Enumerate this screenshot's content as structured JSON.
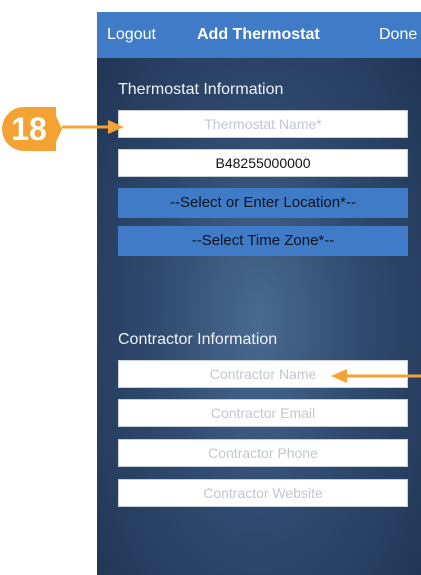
{
  "navbar": {
    "logout_label": "Logout",
    "title": "Add Thermostat",
    "done_label": "Done"
  },
  "thermostat_section": {
    "title": "Thermostat Information",
    "name_placeholder": "Thermostat Name*",
    "serial_value": "B48255000000",
    "location_label": "--Select or Enter Location*--",
    "timezone_label": "--Select Time Zone*--"
  },
  "contractor_section": {
    "title": "Contractor Information",
    "name_placeholder": "Contractor Name",
    "email_placeholder": "Contractor Email",
    "phone_placeholder": "Contractor Phone",
    "website_placeholder": "Contractor Website"
  },
  "callout": {
    "number": "18",
    "color": "#f4a233"
  },
  "colors": {
    "accent": "#3f7bc7",
    "background": "#2f4a6e"
  }
}
